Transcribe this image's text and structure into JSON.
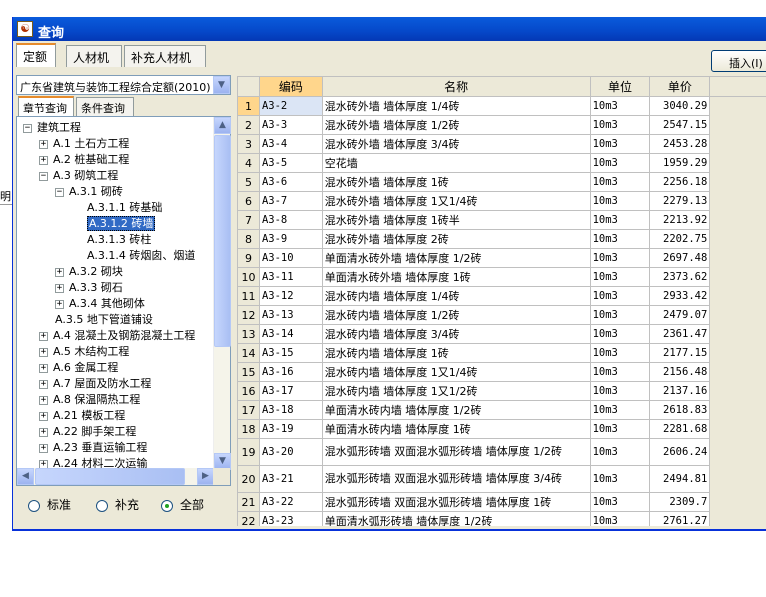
{
  "window": {
    "title": "查询"
  },
  "ghost": {
    "label": "明"
  },
  "tabs": [
    "定额",
    "人材机",
    "补充人材机"
  ],
  "insert_button": "插入(I)",
  "combo": {
    "value": "广东省建筑与装饰工程综合定额(2010)"
  },
  "subtabs": [
    "章节查询",
    "条件查询"
  ],
  "tree": {
    "nodes": [
      {
        "label": "建筑工程",
        "depth": 0,
        "toggle": "−"
      },
      {
        "label": "A.1 土石方工程",
        "depth": 1,
        "toggle": "+"
      },
      {
        "label": "A.2 桩基础工程",
        "depth": 1,
        "toggle": "+"
      },
      {
        "label": "A.3 砌筑工程",
        "depth": 1,
        "toggle": "−"
      },
      {
        "label": "A.3.1 砌砖",
        "depth": 2,
        "toggle": "−"
      },
      {
        "label": "A.3.1.1 砖基础",
        "depth": 3,
        "toggle": ""
      },
      {
        "label": "A.3.1.2 砖墙",
        "depth": 3,
        "toggle": "",
        "selected": true
      },
      {
        "label": "A.3.1.3 砖柱",
        "depth": 3,
        "toggle": ""
      },
      {
        "label": "A.3.1.4 砖烟囱、烟道",
        "depth": 3,
        "toggle": ""
      },
      {
        "label": "A.3.2 砌块",
        "depth": 2,
        "toggle": "+"
      },
      {
        "label": "A.3.3 砌石",
        "depth": 2,
        "toggle": "+"
      },
      {
        "label": "A.3.4 其他砌体",
        "depth": 2,
        "toggle": "+"
      },
      {
        "label": "A.3.5 地下管道铺设",
        "depth": 2,
        "toggle": ""
      },
      {
        "label": "A.4 混凝土及钢筋混凝土工程",
        "depth": 1,
        "toggle": "+"
      },
      {
        "label": "A.5 木结构工程",
        "depth": 1,
        "toggle": "+"
      },
      {
        "label": "A.6 金属工程",
        "depth": 1,
        "toggle": "+"
      },
      {
        "label": "A.7 屋面及防水工程",
        "depth": 1,
        "toggle": "+"
      },
      {
        "label": "A.8 保温隔热工程",
        "depth": 1,
        "toggle": "+"
      },
      {
        "label": "A.21 模板工程",
        "depth": 1,
        "toggle": "+"
      },
      {
        "label": "A.22 脚手架工程",
        "depth": 1,
        "toggle": "+"
      },
      {
        "label": "A.23 垂直运输工程",
        "depth": 1,
        "toggle": "+"
      },
      {
        "label": "A.24 材料二次运输",
        "depth": 1,
        "toggle": "+"
      }
    ]
  },
  "radios": [
    {
      "label": "标准",
      "checked": false
    },
    {
      "label": "补充",
      "checked": false
    },
    {
      "label": "全部",
      "checked": true
    }
  ],
  "grid": {
    "headers": [
      "编码",
      "名称",
      "单位",
      "单价"
    ],
    "rows": [
      {
        "n": "1",
        "code": "A3-2",
        "name": "混水砖外墙 墙体厚度 1/4砖",
        "unit": "10m3",
        "price": "3040.29"
      },
      {
        "n": "2",
        "code": "A3-3",
        "name": "混水砖外墙 墙体厚度 1/2砖",
        "unit": "10m3",
        "price": "2547.15"
      },
      {
        "n": "3",
        "code": "A3-4",
        "name": "混水砖外墙 墙体厚度 3/4砖",
        "unit": "10m3",
        "price": "2453.28"
      },
      {
        "n": "4",
        "code": "A3-5",
        "name": "空花墙",
        "unit": "10m3",
        "price": "1959.29"
      },
      {
        "n": "5",
        "code": "A3-6",
        "name": "混水砖外墙 墙体厚度 1砖",
        "unit": "10m3",
        "price": "2256.18"
      },
      {
        "n": "6",
        "code": "A3-7",
        "name": "混水砖外墙 墙体厚度 1又1/4砖",
        "unit": "10m3",
        "price": "2279.13"
      },
      {
        "n": "7",
        "code": "A3-8",
        "name": "混水砖外墙 墙体厚度 1砖半",
        "unit": "10m3",
        "price": "2213.92"
      },
      {
        "n": "8",
        "code": "A3-9",
        "name": "混水砖外墙 墙体厚度 2砖",
        "unit": "10m3",
        "price": "2202.75"
      },
      {
        "n": "9",
        "code": "A3-10",
        "name": "单面清水砖外墙 墙体厚度 1/2砖",
        "unit": "10m3",
        "price": "2697.48"
      },
      {
        "n": "10",
        "code": "A3-11",
        "name": "单面清水砖外墙 墙体厚度 1砖",
        "unit": "10m3",
        "price": "2373.62"
      },
      {
        "n": "11",
        "code": "A3-12",
        "name": "混水砖内墙 墙体厚度 1/4砖",
        "unit": "10m3",
        "price": "2933.42"
      },
      {
        "n": "12",
        "code": "A3-13",
        "name": "混水砖内墙 墙体厚度 1/2砖",
        "unit": "10m3",
        "price": "2479.07"
      },
      {
        "n": "13",
        "code": "A3-14",
        "name": "混水砖内墙 墙体厚度 3/4砖",
        "unit": "10m3",
        "price": "2361.47"
      },
      {
        "n": "14",
        "code": "A3-15",
        "name": "混水砖内墙 墙体厚度 1砖",
        "unit": "10m3",
        "price": "2177.15"
      },
      {
        "n": "15",
        "code": "A3-16",
        "name": "混水砖内墙 墙体厚度 1又1/4砖",
        "unit": "10m3",
        "price": "2156.48"
      },
      {
        "n": "16",
        "code": "A3-17",
        "name": "混水砖内墙 墙体厚度 1又1/2砖",
        "unit": "10m3",
        "price": "2137.16"
      },
      {
        "n": "17",
        "code": "A3-18",
        "name": "单面清水砖内墙 墙体厚度 1/2砖",
        "unit": "10m3",
        "price": "2618.83"
      },
      {
        "n": "18",
        "code": "A3-19",
        "name": "单面清水砖内墙 墙体厚度 1砖",
        "unit": "10m3",
        "price": "2281.68"
      },
      {
        "n": "19",
        "code": "A3-20",
        "name": "混水弧形砖墙 双面混水弧形砖墙 墙体厚度 1/2砖",
        "unit": "10m3",
        "price": "2606.24",
        "tall": true
      },
      {
        "n": "20",
        "code": "A3-21",
        "name": "混水弧形砖墙 双面混水弧形砖墙 墙体厚度 3/4砖",
        "unit": "10m3",
        "price": "2494.81",
        "tall": true
      },
      {
        "n": "21",
        "code": "A3-22",
        "name": "混水弧形砖墙 双面混水弧形砖墙 墙体厚度 1砖",
        "unit": "10m3",
        "price": "2309.7"
      },
      {
        "n": "22",
        "code": "A3-23",
        "name": "单面清水弧形砖墙 墙体厚度 1/2砖",
        "unit": "10m3",
        "price": "2761.27"
      }
    ]
  },
  "colors": {
    "title_bar": "#0548c9",
    "selection": "#316ac5",
    "header_highlight": "#ffd68c"
  },
  "icons": [
    "app-icon",
    "chevron-down-icon",
    "up-arrow-icon",
    "down-arrow-icon",
    "left-arrow-icon",
    "right-arrow-icon"
  ]
}
